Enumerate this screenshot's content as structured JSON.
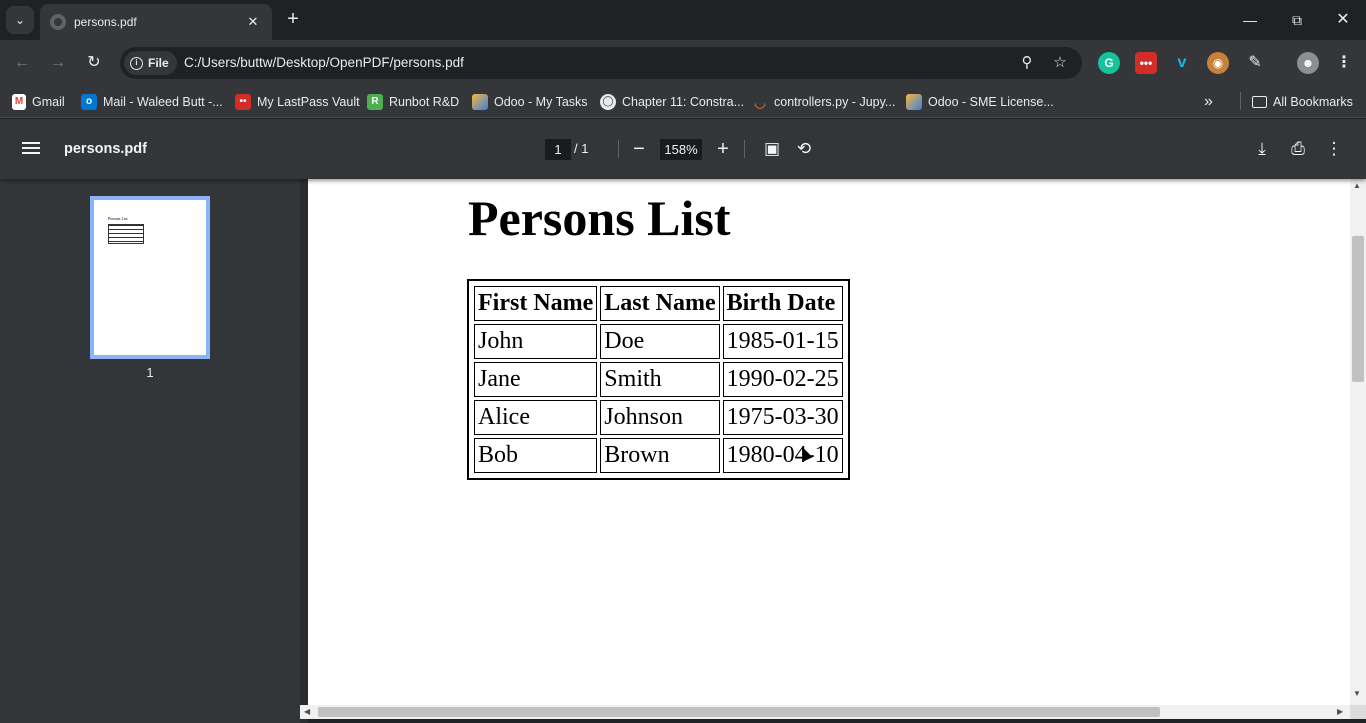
{
  "browser": {
    "tab": {
      "title": "persons.pdf"
    },
    "address": {
      "chip": "File",
      "url": "C:/Users/buttw/Desktop/OpenPDF/persons.pdf"
    },
    "bookmarks": [
      {
        "label": "Gmail",
        "icon": "gmail-icon",
        "color": "#ea4335"
      },
      {
        "label": "Mail - Waleed Butt -...",
        "icon": "outlook-icon",
        "color": "#0078d4"
      },
      {
        "label": "My LastPass Vault",
        "icon": "lastpass-icon",
        "color": "#d32d27"
      },
      {
        "label": "Runbot R&D",
        "icon": "runbot-icon",
        "color": "#4caf50"
      },
      {
        "label": "Odoo - My Tasks",
        "icon": "odoo-icon",
        "color": "#f6b93b"
      },
      {
        "label": "Chapter 11: Constra...",
        "icon": "globe-icon",
        "color": "#e8eaed"
      },
      {
        "label": "controllers.py - Jupy...",
        "icon": "jupyter-icon",
        "color": "#f37726"
      },
      {
        "label": "Odoo - SME License...",
        "icon": "odoo-icon",
        "color": "#f6b93b"
      }
    ],
    "all_bookmarks": "All Bookmarks"
  },
  "pdf": {
    "title": "persons.pdf",
    "page_current": "1",
    "page_total": "/  1",
    "zoom": "158%",
    "thumbnail_page": "1",
    "thumbnail_title": "Persons List"
  },
  "document": {
    "heading": "Persons List",
    "columns": [
      "First Name",
      "Last Name",
      "Birth Date"
    ],
    "rows": [
      [
        "John",
        "Doe",
        "1985-01-15"
      ],
      [
        "Jane",
        "Smith",
        "1990-02-25"
      ],
      [
        "Alice",
        "Johnson",
        "1975-03-30"
      ],
      [
        "Bob",
        "Brown",
        "1980-04-10"
      ]
    ]
  }
}
